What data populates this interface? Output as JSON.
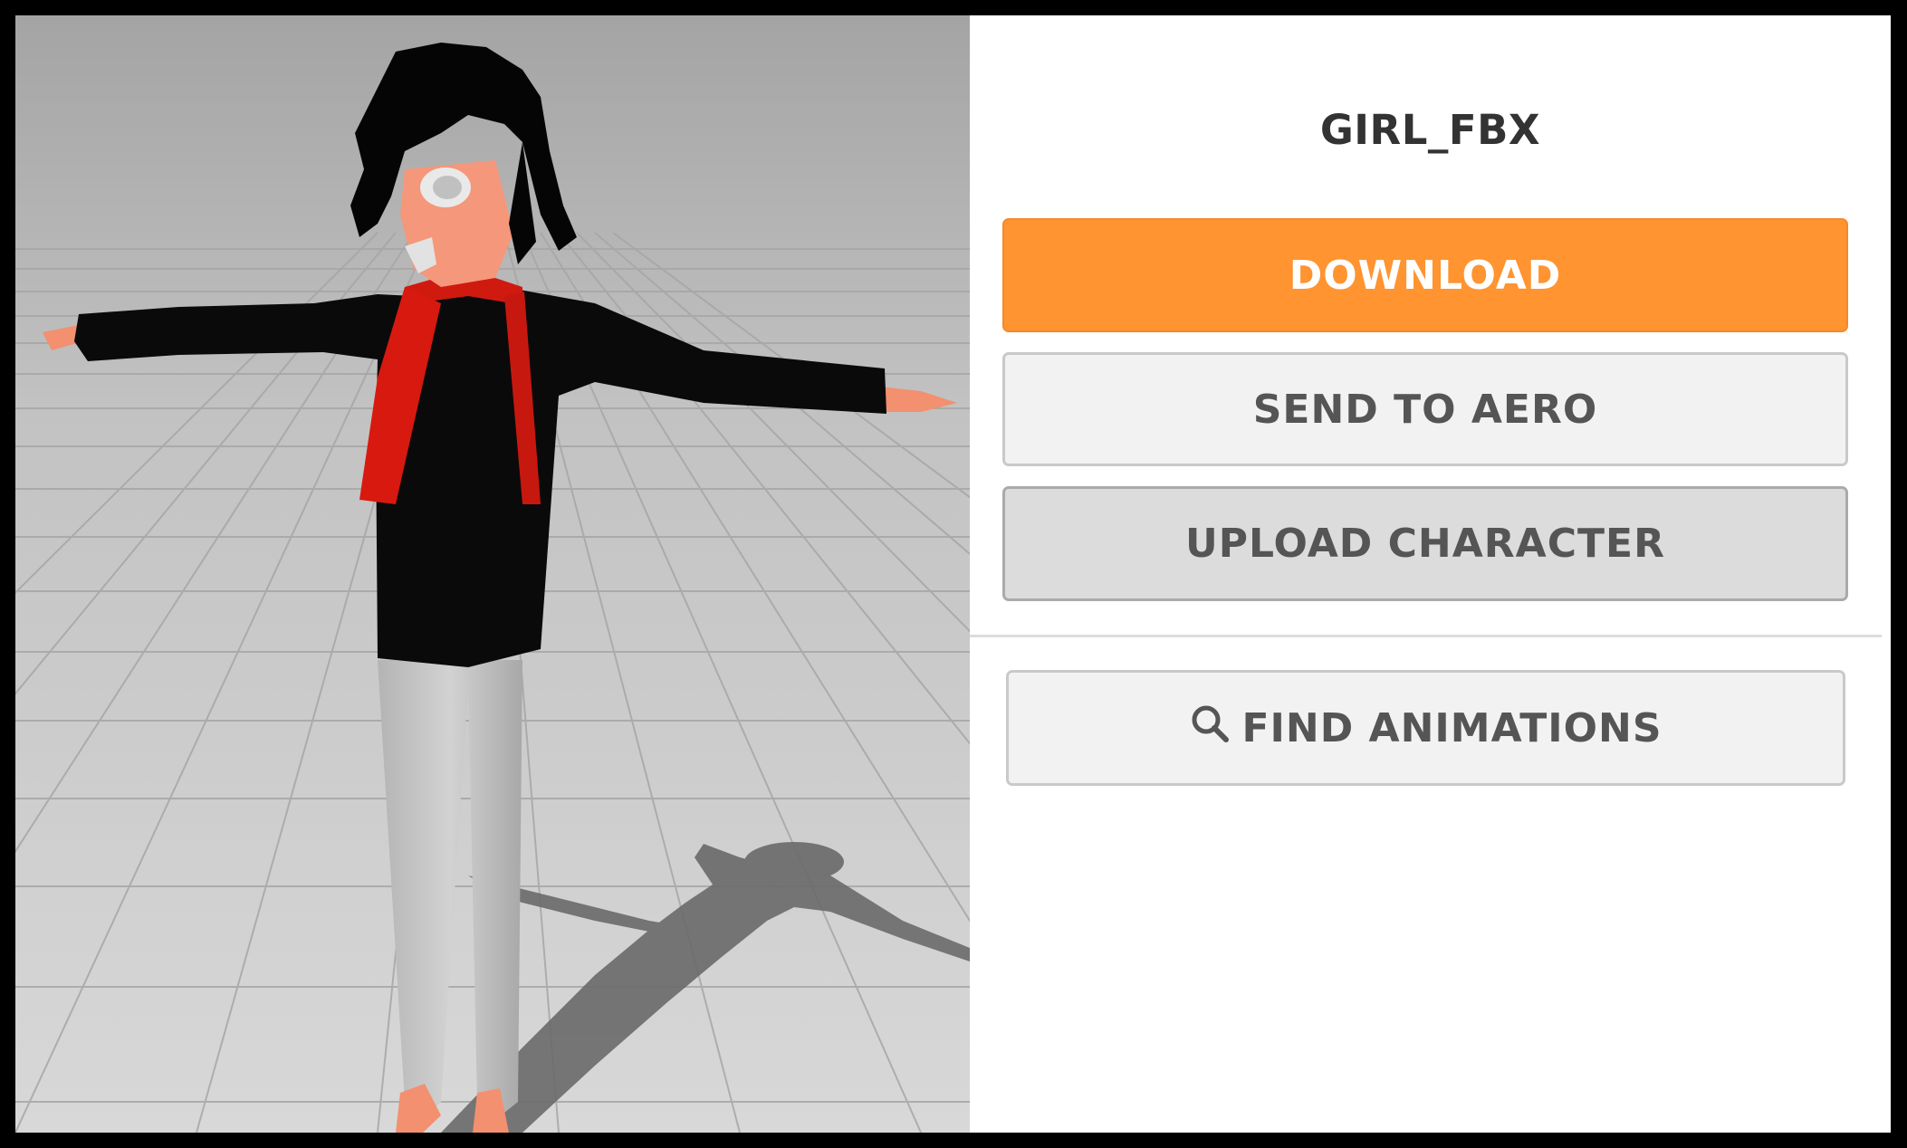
{
  "character": {
    "name": "GIRL_FBX"
  },
  "actions": {
    "download_label": "DOWNLOAD",
    "send_to_aero_label": "SEND TO AERO",
    "upload_character_label": "UPLOAD CHARACTER",
    "find_animations_label": "FIND ANIMATIONS",
    "find_animations_icon": "search-icon"
  },
  "colors": {
    "accent": "#ff9430",
    "button_secondary": "#f2f2f2",
    "button_upload": "#dcdcdc",
    "text_dark": "#333333"
  }
}
